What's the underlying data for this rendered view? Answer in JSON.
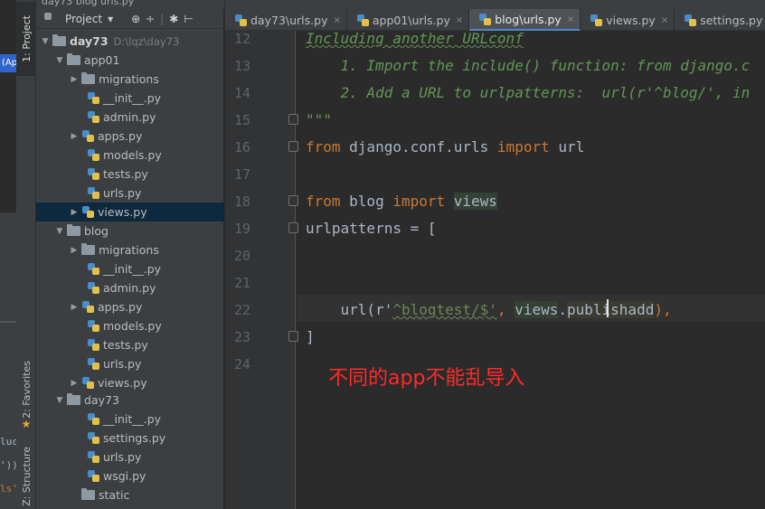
{
  "left_sliver": {
    "tag": "(Ap",
    "code_lines": [
      "luc",
      "'))",
      "ls'"
    ]
  },
  "tool_tabs": {
    "project": "1: Project",
    "favorites": "2: Favorites",
    "structure": "Z: Structure"
  },
  "breadcrumb_top": "day73   blog   urls.py",
  "project_toolbar": {
    "label": "Project",
    "dropdown": "▾",
    "icons": [
      "sync-icon",
      "collapse-icon",
      "gear-icon",
      "hide-icon"
    ]
  },
  "tree": {
    "root": {
      "name": "day73",
      "path": "D:\\lqz\\day73"
    },
    "app01": "app01",
    "app01_migrations": "migrations",
    "app01_init": "__init__.py",
    "app01_admin": "admin.py",
    "app01_apps": "apps.py",
    "app01_models": "models.py",
    "app01_tests": "tests.py",
    "app01_urls": "urls.py",
    "app01_views": "views.py",
    "blog": "blog",
    "blog_migrations": "migrations",
    "blog_init": "__init__.py",
    "blog_admin": "admin.py",
    "blog_apps": "apps.py",
    "blog_models": "models.py",
    "blog_tests": "tests.py",
    "blog_urls": "urls.py",
    "blog_views": "views.py",
    "day73": "day73",
    "day73_init": "__init__.py",
    "day73_settings": "settings.py",
    "day73_urls": "urls.py",
    "day73_wsgi": "wsgi.py",
    "static": "static"
  },
  "tabs": [
    {
      "label": "day73\\urls.py",
      "close": "×"
    },
    {
      "label": "app01\\urls.py",
      "close": "×"
    },
    {
      "label": "blog\\urls.py",
      "close": "×",
      "active": true
    },
    {
      "label": "views.py",
      "close": "×"
    },
    {
      "label": "settings.py",
      "close": "×"
    }
  ],
  "editor": {
    "line_numbers": [
      "12",
      "13",
      "14",
      "15",
      "16",
      "17",
      "18",
      "19",
      "20",
      "21",
      "22",
      "23",
      "24"
    ],
    "line12": "Including another URLconf",
    "line13": "    1. Import the include() function: from django.c",
    "line14": "    2. Add a URL to urlpatterns:  url(r'^blog/', in",
    "line15": "\"\"\"",
    "line16_kw1": "from",
    "line16_mod": " django.conf.urls ",
    "line16_kw2": "import",
    "line16_name": " url",
    "line18_kw1": "from",
    "line18_mod": " blog ",
    "line18_kw2": "import",
    "line18_name": "views",
    "line19": "urlpatterns = [",
    "line22_a": "    url(r'",
    "line22_b": "^blogtest/$'",
    "line22_c": ", ",
    "line22_d": "views",
    "line22_e": ".",
    "line22_f": "publishadd",
    "line22_g": "),",
    "line23": "]"
  },
  "annotation": "不同的app不能乱导入"
}
